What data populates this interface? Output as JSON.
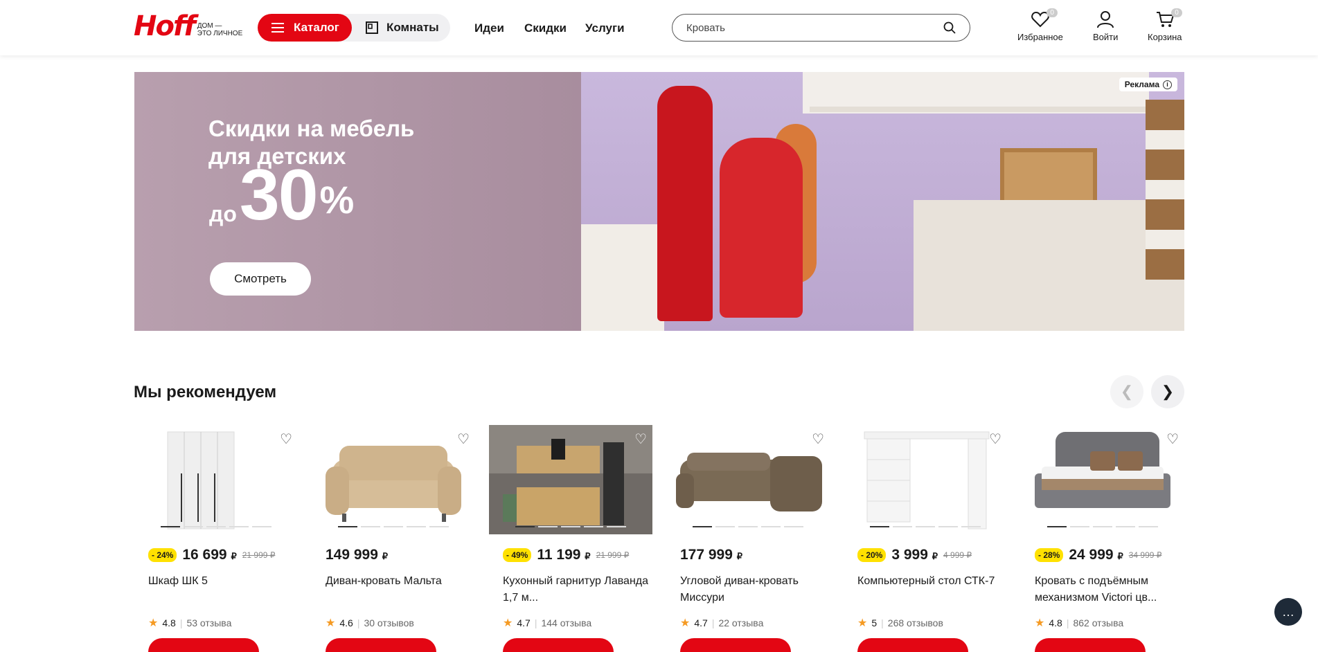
{
  "header": {
    "logo_word": "Hoff",
    "logo_tagline_1": "дом —",
    "logo_tagline_2": "это личное",
    "catalog_label": "Каталог",
    "rooms_label": "Комнаты",
    "nav": [
      "Идеи",
      "Скидки",
      "Услуги"
    ],
    "search_placeholder": "Кровать",
    "favorites_label": "Избранное",
    "favorites_count": "0",
    "login_label": "Войти",
    "cart_label": "Корзина",
    "cart_count": "0"
  },
  "banner": {
    "ad_label": "Реклама",
    "title": "Скидки на мебель для детских",
    "prefix": "до",
    "number": "30",
    "percent": "%",
    "button": "Смотреть"
  },
  "recommend": {
    "title": "Мы рекомендуем",
    "products": [
      {
        "discount": "- 24%",
        "price": "16 699",
        "currency": "₽",
        "old_price": "21 999 ₽",
        "name": "Шкаф ШК 5",
        "rating": "4.8",
        "reviews": "53 отзыва"
      },
      {
        "discount": "",
        "price": "149 999",
        "currency": "₽",
        "old_price": "",
        "name": "Диван-кровать Мальта",
        "rating": "4.6",
        "reviews": "30 отзывов"
      },
      {
        "discount": "- 49%",
        "price": "11 199",
        "currency": "₽",
        "old_price": "21 999 ₽",
        "name": "Кухонный гарнитур Лаванда 1,7 м...",
        "rating": "4.7",
        "reviews": "144 отзыва"
      },
      {
        "discount": "",
        "price": "177 999",
        "currency": "₽",
        "old_price": "",
        "name": "Угловой диван-кровать Миссури",
        "rating": "4.7",
        "reviews": "22 отзыва"
      },
      {
        "discount": "- 20%",
        "price": "3 999",
        "currency": "₽",
        "old_price": "4 999 ₽",
        "name": "Компьютерный стол СТК-7",
        "rating": "5",
        "reviews": "268 отзывов"
      },
      {
        "discount": "- 28%",
        "price": "24 999",
        "currency": "₽",
        "old_price": "34 999 ₽",
        "name": "Кровать с подъёмным механизмом Victori цв...",
        "rating": "4.8",
        "reviews": "862 отзыва"
      }
    ]
  },
  "colors": {
    "brand": "#e30613",
    "discount_badge": "#ffe100",
    "star": "#f59a23"
  }
}
